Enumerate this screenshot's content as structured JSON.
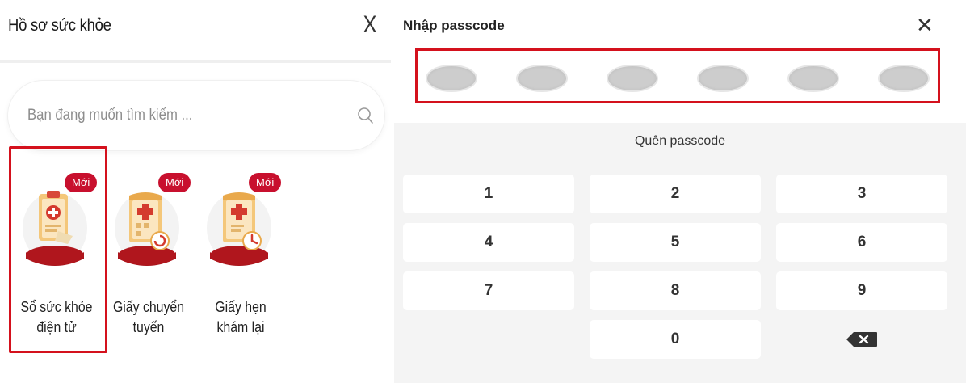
{
  "health_panel": {
    "title": "Hồ sơ sức khỏe",
    "close_glyph": "X",
    "search": {
      "placeholder": "Bạn đang muốn tìm kiếm ...",
      "icon": "search-icon"
    },
    "items": [
      {
        "badge": "Mới",
        "label_line1": "Sổ sức khỏe",
        "label_line2": "điện tử",
        "icon": "health-record-clipboard-icon"
      },
      {
        "badge": "Mới",
        "label_line1": "Giấy chuyển",
        "label_line2": "tuyến",
        "icon": "referral-paper-icon"
      },
      {
        "badge": "Mới",
        "label_line1": "Giấy hẹn",
        "label_line2": "khám lại",
        "icon": "appointment-paper-icon"
      }
    ],
    "colors": {
      "accent": "#c8102e",
      "highlight": "#d4111d"
    }
  },
  "passcode_panel": {
    "title": "Nhập passcode",
    "close_glyph": "✕",
    "dot_count": 6,
    "forgot": "Quên passcode",
    "keys": [
      "1",
      "2",
      "3",
      "4",
      "5",
      "6",
      "7",
      "8",
      "9",
      "0"
    ],
    "backspace_icon": "backspace-icon"
  }
}
